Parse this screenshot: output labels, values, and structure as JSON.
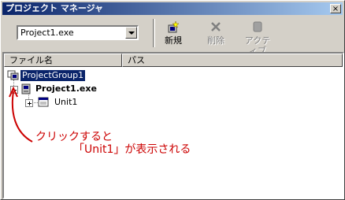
{
  "window": {
    "title": "プロジェクト マネージャ",
    "close_glyph": "×"
  },
  "toolbar": {
    "project_combo_value": "Project1.exe",
    "new_label": "新規",
    "delete_label": "削除",
    "activate_label": "アクティブ"
  },
  "columns": {
    "file_name": "ファイル名",
    "path": "パス"
  },
  "tree": {
    "group": "ProjectGroup1",
    "project": "Project1.exe",
    "unit": "Unit1"
  },
  "annotation": {
    "line1": "クリックすると",
    "line2": "「Unit1」が表示される",
    "color": "#cc0000"
  }
}
